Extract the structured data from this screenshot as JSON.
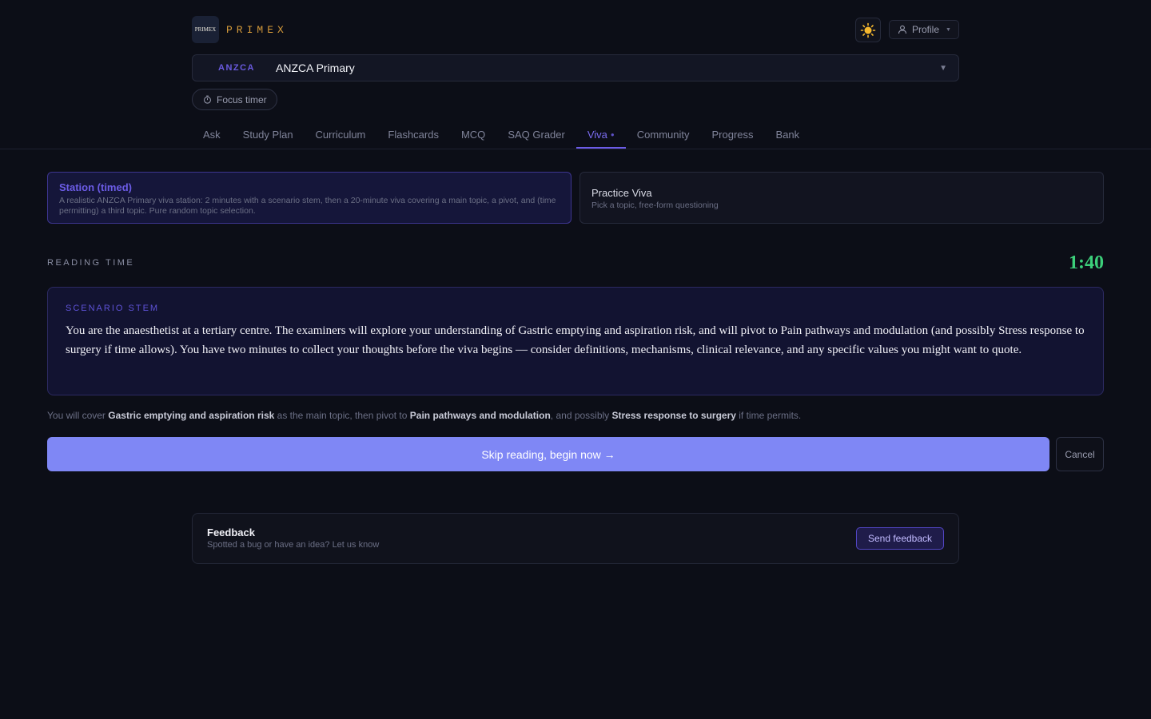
{
  "app": {
    "logo_text": "PRIMEX",
    "brand": "PRIMEX"
  },
  "header": {
    "theme_icon": "sun-icon",
    "profile_label": "Profile"
  },
  "exam": {
    "code": "ANZCA",
    "name": "ANZCA Primary"
  },
  "focus_timer_label": "Focus timer",
  "tabs": [
    {
      "label": "Ask"
    },
    {
      "label": "Study Plan"
    },
    {
      "label": "Curriculum"
    },
    {
      "label": "Flashcards"
    },
    {
      "label": "MCQ"
    },
    {
      "label": "SAQ Grader"
    },
    {
      "label": "Viva",
      "active": true
    },
    {
      "label": "Community"
    },
    {
      "label": "Progress"
    },
    {
      "label": "Bank"
    }
  ],
  "modes": {
    "station": {
      "title": "Station (timed)",
      "description": "A realistic ANZCA Primary viva station: 2 minutes with a scenario stem, then a 20-minute viva covering a main topic, a pivot, and (time permitting) a third topic. Pure random topic selection."
    },
    "practice": {
      "title": "Practice Viva",
      "description": "Pick a topic, free-form questioning"
    }
  },
  "reading": {
    "label": "READING TIME",
    "timer": "1:40"
  },
  "stem": {
    "label": "SCENARIO STEM",
    "text": "You are the anaesthetist at a tertiary centre. The examiners will explore your understanding of Gastric emptying and aspiration risk, and will pivot to Pain pathways and modulation (and possibly Stress response to surgery if time allows). You have two minutes to collect your thoughts before the viva begins — consider definitions, mechanisms, clinical relevance, and any specific values you might want to quote."
  },
  "coverage": {
    "prefix": "You will cover ",
    "main_topic": "Gastric emptying and aspiration risk",
    "middle": " as the main topic, then pivot to ",
    "pivot_topic": "Pain pathways and modulation",
    "middle2": ", and possibly ",
    "third_topic": "Stress response to surgery",
    "suffix": " if time permits."
  },
  "actions": {
    "skip_label": "Skip reading, begin now →",
    "cancel_label": "Cancel"
  },
  "feedback": {
    "title": "Feedback",
    "description": "Spotted a bug or have an idea? Let us know",
    "button_label": "Send feedback"
  },
  "colors": {
    "accent": "#6c5ce7",
    "timer": "#3ccf7a",
    "brand": "#d59a3a",
    "primary_button": "#7f87f5"
  }
}
